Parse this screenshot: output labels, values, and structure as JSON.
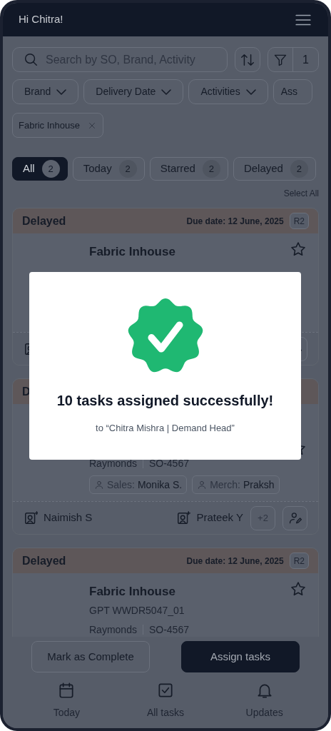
{
  "header": {
    "greeting": "Hi Chitra!"
  },
  "search": {
    "placeholder": "Search by SO, Brand, Activity"
  },
  "filter": {
    "count": "1"
  },
  "filters": [
    "Brand",
    "Delivery Date",
    "Activities",
    "Ass"
  ],
  "applied_filters": [
    "Fabric Inhouse"
  ],
  "tabs": [
    {
      "label": "All",
      "count": "2",
      "selected": true
    },
    {
      "label": "Today",
      "count": "2",
      "selected": false
    },
    {
      "label": "Starred",
      "count": "2",
      "selected": false
    },
    {
      "label": "Delayed",
      "count": "2",
      "selected": false
    }
  ],
  "select_all": "Select All",
  "tasks": [
    {
      "status": "Delayed",
      "due_date": "Due date: 12 June, 2025",
      "badge": "R2",
      "title": "Fabric Inhouse",
      "starred": false
    },
    {
      "status": "D",
      "starred": false,
      "brand": "Raymonds",
      "so": "SO-4567",
      "people": [
        {
          "role": "Sales:",
          "name": "Monika S."
        },
        {
          "role": "Merch:",
          "name": "Praksh"
        }
      ],
      "assigned_by": "Naimish S",
      "assigned_to": "Prateek Y",
      "more": "+2"
    },
    {
      "status": "Delayed",
      "due_date": "Due date: 12 June, 2025",
      "badge": "R2",
      "title": "Fabric Inhouse",
      "code": "GPT WWDR5047_01",
      "starred": false,
      "brand": "Raymonds",
      "so": "SO-4567"
    }
  ],
  "actions": [
    {
      "label": "Mark as Complete",
      "kind": "secondary"
    },
    {
      "label": "Assign tasks",
      "kind": "primary"
    }
  ],
  "nav": [
    {
      "label": "Today"
    },
    {
      "label": "All tasks"
    },
    {
      "label": "Updates"
    }
  ],
  "modal": {
    "title": "10 tasks assigned successfully!",
    "subtitle": "to “Chitra Mishra | Demand Head”"
  }
}
